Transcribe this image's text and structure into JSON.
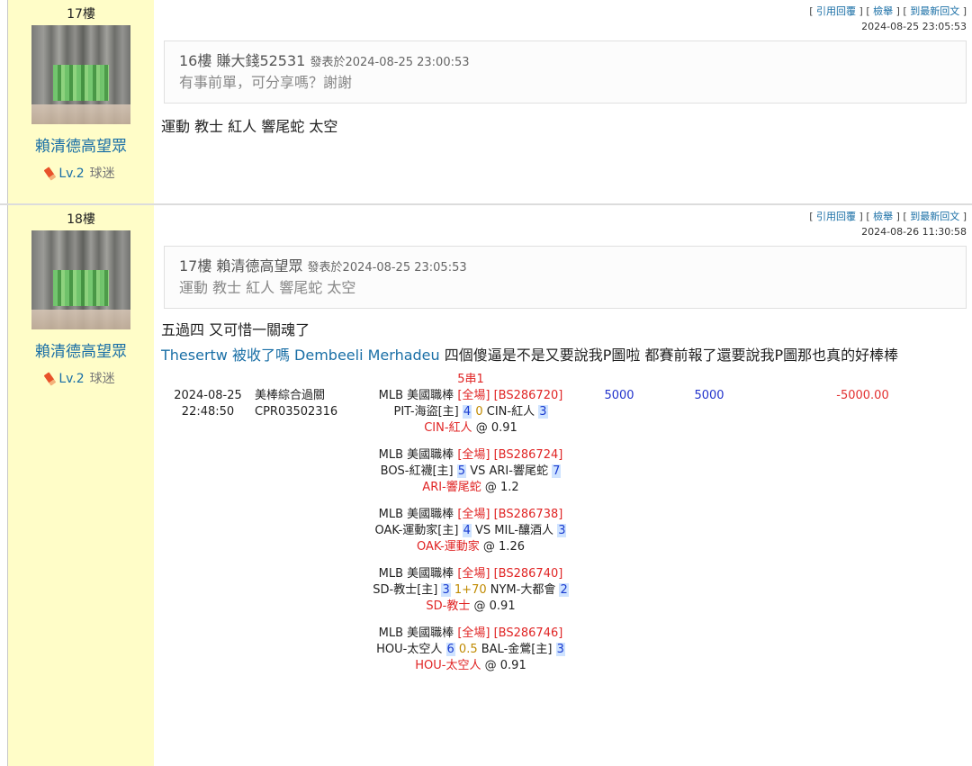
{
  "posts": [
    {
      "floor": "17樓",
      "username": "賴清德高望眾",
      "level_num": "Lv.2",
      "level_name": "球迷",
      "links": {
        "quote": "引用回覆",
        "report": "檢舉",
        "latest": "到最新回文"
      },
      "time": "2024-08-25 23:05:53",
      "quote": {
        "ref": "16樓 賺大錢52531",
        "posted": "發表於2024-08-25 23:00:53",
        "text": "有事前單，可分享嗎？謝謝"
      },
      "body": "運動 教士  紅人 響尾蛇 太空"
    },
    {
      "floor": "18樓",
      "username": "賴清德高望眾",
      "level_num": "Lv.2",
      "level_name": "球迷",
      "links": {
        "quote": "引用回覆",
        "report": "檢舉",
        "latest": "到最新回文"
      },
      "time": "2024-08-26 11:30:58",
      "quote": {
        "ref": "17樓 賴清德高望眾",
        "posted": "發表於2024-08-25 23:05:53",
        "text": "運動 教士 紅人 響尾蛇 太空"
      },
      "body1": "五過四 又可惜一關魂了",
      "body2_blue": "Thesertw  被收了嗎 Dembeeli Merhadeu",
      "body2_black": "  四個傻逼是不是又要說我P圖啦  都賽前報了還要說我P圖那也真的好棒棒",
      "bet": {
        "date": "2024-08-25",
        "time": "22:48:50",
        "type": "美棒綜合過關",
        "code": "CPR03502316",
        "combo": "5串1",
        "amount1": "5000",
        "amount2": "5000",
        "result": "-5000.00",
        "games": [
          {
            "league": "MLB 美國職棒",
            "period": "[全場]",
            "id": "[BS286720]",
            "home": "PIT-海盜[主]",
            "s1": "4",
            "mid": "0",
            "away": "CIN-紅人",
            "s2": "3",
            "pick": "CIN-紅人",
            "odds": "@ 0.91"
          },
          {
            "league": "MLB 美國職棒",
            "period": "[全場]",
            "id": "[BS286724]",
            "home": "BOS-紅襪[主]",
            "s1": "5",
            "mid": "VS",
            "away": "ARI-響尾蛇",
            "s2": "7",
            "pick": "ARI-響尾蛇",
            "odds": "@ 1.2"
          },
          {
            "league": "MLB 美國職棒",
            "period": "[全場]",
            "id": "[BS286738]",
            "home": "OAK-運動家[主]",
            "s1": "4",
            "mid": "VS",
            "away": "MIL-釀酒人",
            "s2": "3",
            "pick": "OAK-運動家",
            "odds": "@ 1.26"
          },
          {
            "league": "MLB 美國職棒",
            "period": "[全場]",
            "id": "[BS286740]",
            "home": "SD-教士[主]",
            "s1": "3",
            "mid": "1+70",
            "away": "NYM-大都會",
            "s2": "2",
            "pick": "SD-教士",
            "odds": "@ 0.91"
          },
          {
            "league": "MLB 美國職棒",
            "period": "[全場]",
            "id": "[BS286746]",
            "home": "HOU-太空人",
            "s1": "6",
            "mid": "0.5",
            "away": "BAL-金鶯[主]",
            "s2": "3",
            "pick": "HOU-太空人",
            "odds": "@ 0.91"
          }
        ]
      }
    }
  ],
  "colors": {
    "sidebar": "#fffdc8",
    "link": "#1a6fa6",
    "red": "#e02424",
    "score_bg": "#cfe3ff"
  }
}
